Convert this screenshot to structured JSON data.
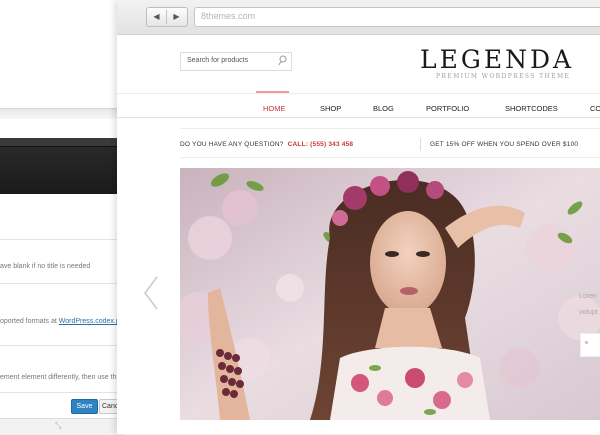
{
  "admin": {
    "hint_title": "ave blank if no title is needed",
    "hint_formats_prefix": "oported formats at ",
    "hint_formats_link": "WordPress.codex.page",
    "hint_element": "ement element differently, then use this field",
    "save_label": "Save",
    "cancel_label": "Canc"
  },
  "browser": {
    "url": "8themes.com",
    "back_icon": "◀",
    "forward_icon": "▶"
  },
  "site": {
    "search_placeholder": "Search for products",
    "logo": "LEGENDA",
    "tagline": "PREMIUM WORDPRESS THEME",
    "nav": [
      "HOME",
      "SHOP",
      "BLOG",
      "PORTFOLIO",
      "SHORTCODES",
      "CO"
    ],
    "question": "DO YOU HAVE ANY QUESTION?",
    "phone": "CALL: (555) 343 458",
    "promo": "GET 15% OFF WHEN YOU SPEND OVER $100",
    "slide_text_1": "Loren",
    "slide_text_2": "volupt"
  },
  "colors": {
    "accent": "#c9353b",
    "active_underline": "#f09aa0",
    "save_button": "#2e83c2"
  }
}
